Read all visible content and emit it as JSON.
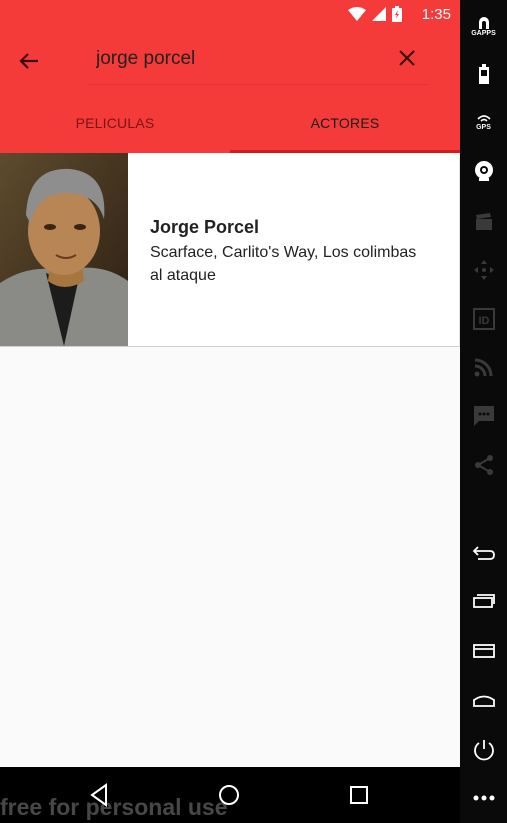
{
  "status_bar": {
    "time": "1:35"
  },
  "toolbar": {
    "search_value": "jorge porcel"
  },
  "tabs": [
    {
      "label": "PELICULAS",
      "active": false
    },
    {
      "label": "ACTORES",
      "active": true
    }
  ],
  "results": [
    {
      "name": "Jorge Porcel",
      "movies": "Scarface, Carlito's Way, Los colimbas al ataque"
    }
  ],
  "sidebar": {
    "gapps_label": "GAPPS",
    "gps_label": "GPS"
  },
  "watermark": "free for personal use",
  "colors": {
    "primary": "#f53a3a",
    "tab_indicator": "#d21b1b",
    "inactive_tab": "#7a1414",
    "sidebar": "#0a0a0a"
  }
}
